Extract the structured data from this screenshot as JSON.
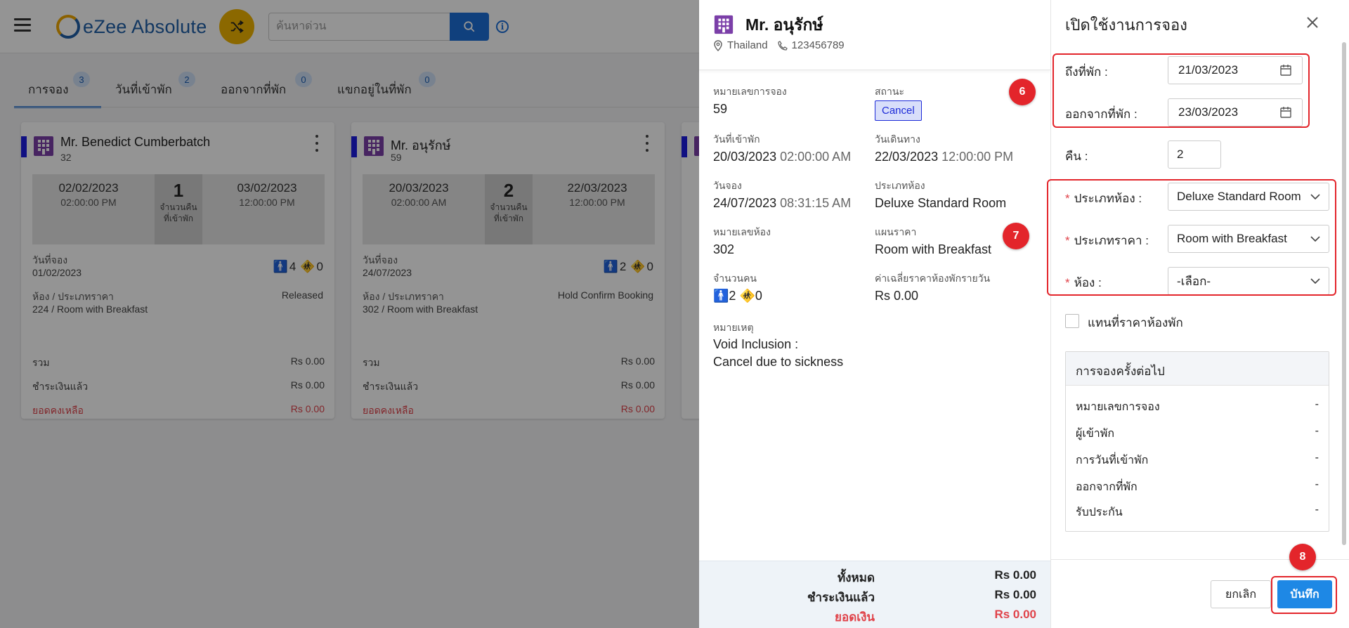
{
  "app": {
    "logo_text": "eZee Absolute",
    "search_placeholder": "ค้นหาด่วน",
    "tabs": [
      {
        "label": "การจอง",
        "count": "3"
      },
      {
        "label": "วันที่เข้าพัก",
        "count": "2"
      },
      {
        "label": "ออกจากที่พัก",
        "count": "0"
      },
      {
        "label": "แขกอยู่ในที่พัก",
        "count": "0"
      }
    ],
    "cards": [
      {
        "guest": "Mr. Benedict Cumberbatch",
        "number": "32",
        "arrival_date": "02/02/2023",
        "arrival_time": "02:00:00 PM",
        "nights": "1",
        "nights_label": "จำนวนคืนที่เข้าพัก",
        "departure_date": "03/02/2023",
        "departure_time": "12:00:00 PM",
        "booking_date_label": "วันที่จอง",
        "booking_date": "01/02/2023",
        "adults": "4",
        "children": "0",
        "room_label": "ห้อง / ประเภทราคา",
        "room": "224 / Room with Breakfast",
        "status": "Released",
        "total_label": "รวม",
        "total": "Rs 0.00",
        "paid_label": "ชำระเงินแล้ว",
        "paid": "Rs 0.00",
        "balance_label": "ยอดคงเหลือ",
        "balance": "Rs 0.00"
      },
      {
        "guest": "Mr. อนุรักษ์",
        "number": "59",
        "arrival_date": "20/03/2023",
        "arrival_time": "02:00:00 AM",
        "nights": "2",
        "nights_label": "จำนวนคืนที่เข้าพัก",
        "departure_date": "22/03/2023",
        "departure_time": "12:00:00 PM",
        "booking_date_label": "วันที่จอง",
        "booking_date": "24/07/2023",
        "adults": "2",
        "children": "0",
        "room_label": "ห้อง / ประเภทราคา",
        "room": "302 / Room with Breakfast",
        "status": "Hold Confirm Booking",
        "total_label": "รวม",
        "total": "Rs 0.00",
        "paid_label": "ชำระเงินแล้ว",
        "paid": "Rs 0.00",
        "balance_label": "ยอดคงเหลือ",
        "balance": "Rs 0.00"
      }
    ]
  },
  "detail": {
    "guest_name": "Mr. อนุรักษ์",
    "country": "Thailand",
    "phone": "123456789",
    "booking_no_label": "หมายเลขการจอง",
    "booking_no": "59",
    "status_label": "สถานะ",
    "status": "Cancel",
    "arrival_label": "วันที่เข้าพัก",
    "arrival_date": "20/03/2023",
    "arrival_time": "02:00:00 AM",
    "departure_label": "วันเดินทาง",
    "departure_date": "22/03/2023",
    "departure_time": "12:00:00 PM",
    "booking_date_label": "วันจอง",
    "booking_date": "24/07/2023",
    "booking_time": "08:31:15 AM",
    "room_type_label": "ประเภทห้อง",
    "room_type": "Deluxe Standard Room",
    "room_no_label": "หมายเลขห้อง",
    "room_no": "302",
    "rate_plan_label": "แผนราคา",
    "rate_plan": "Room with Breakfast",
    "pax_label": "จำนวนคน",
    "adults": "2",
    "children": "0",
    "avg_rate_label": "ค่าเฉลี่ยราคาห้องพักรายวัน",
    "avg_rate": "Rs 0.00",
    "remark_label": "หมายเหตุ",
    "remark_line1": "Void Inclusion :",
    "remark_line2": "Cancel due to sickness",
    "total_label": "ทั้งหมด",
    "total": "Rs 0.00",
    "paid_label": "ชำระเงินแล้ว",
    "paid": "Rs 0.00",
    "balance_label": "ยอดเงิน",
    "balance": "Rs 0.00"
  },
  "panel": {
    "title": "เปิดใช้งานการจอง",
    "arrival_label": "ถึงที่พัก :",
    "arrival_value": "21/03/2023",
    "departure_label": "ออกจากที่พัก :",
    "departure_value": "23/03/2023",
    "nights_label": "คืน :",
    "nights_value": "2",
    "room_type_label": "ประเภทห้อง :",
    "room_type_value": "Deluxe Standard Room",
    "rate_type_label": "ประเภทราคา :",
    "rate_type_value": "Room with Breakfast",
    "room_label": "ห้อง :",
    "room_value": "-เลือก-",
    "override_label": "แทนที่ราคาห้องพัก",
    "next_title": "การจองครั้งต่อไป",
    "next_rows": [
      {
        "label": "หมายเลขการจอง",
        "value": "-"
      },
      {
        "label": "ผู้เข้าพัก",
        "value": "-"
      },
      {
        "label": "การวันที่เข้าพัก",
        "value": "-"
      },
      {
        "label": "ออกจากที่พัก",
        "value": "-"
      },
      {
        "label": "รับประกัน",
        "value": "-"
      }
    ],
    "cancel_label": "ยกเลิก",
    "save_label": "บันทึก"
  },
  "annotations": {
    "step6": "6",
    "step7": "7",
    "step8": "8"
  },
  "colors": {
    "primary": "#1e88e5",
    "highlight": "#e3252b",
    "status_cancel": "#1d2bd8",
    "balance_red": "#e0434a"
  }
}
